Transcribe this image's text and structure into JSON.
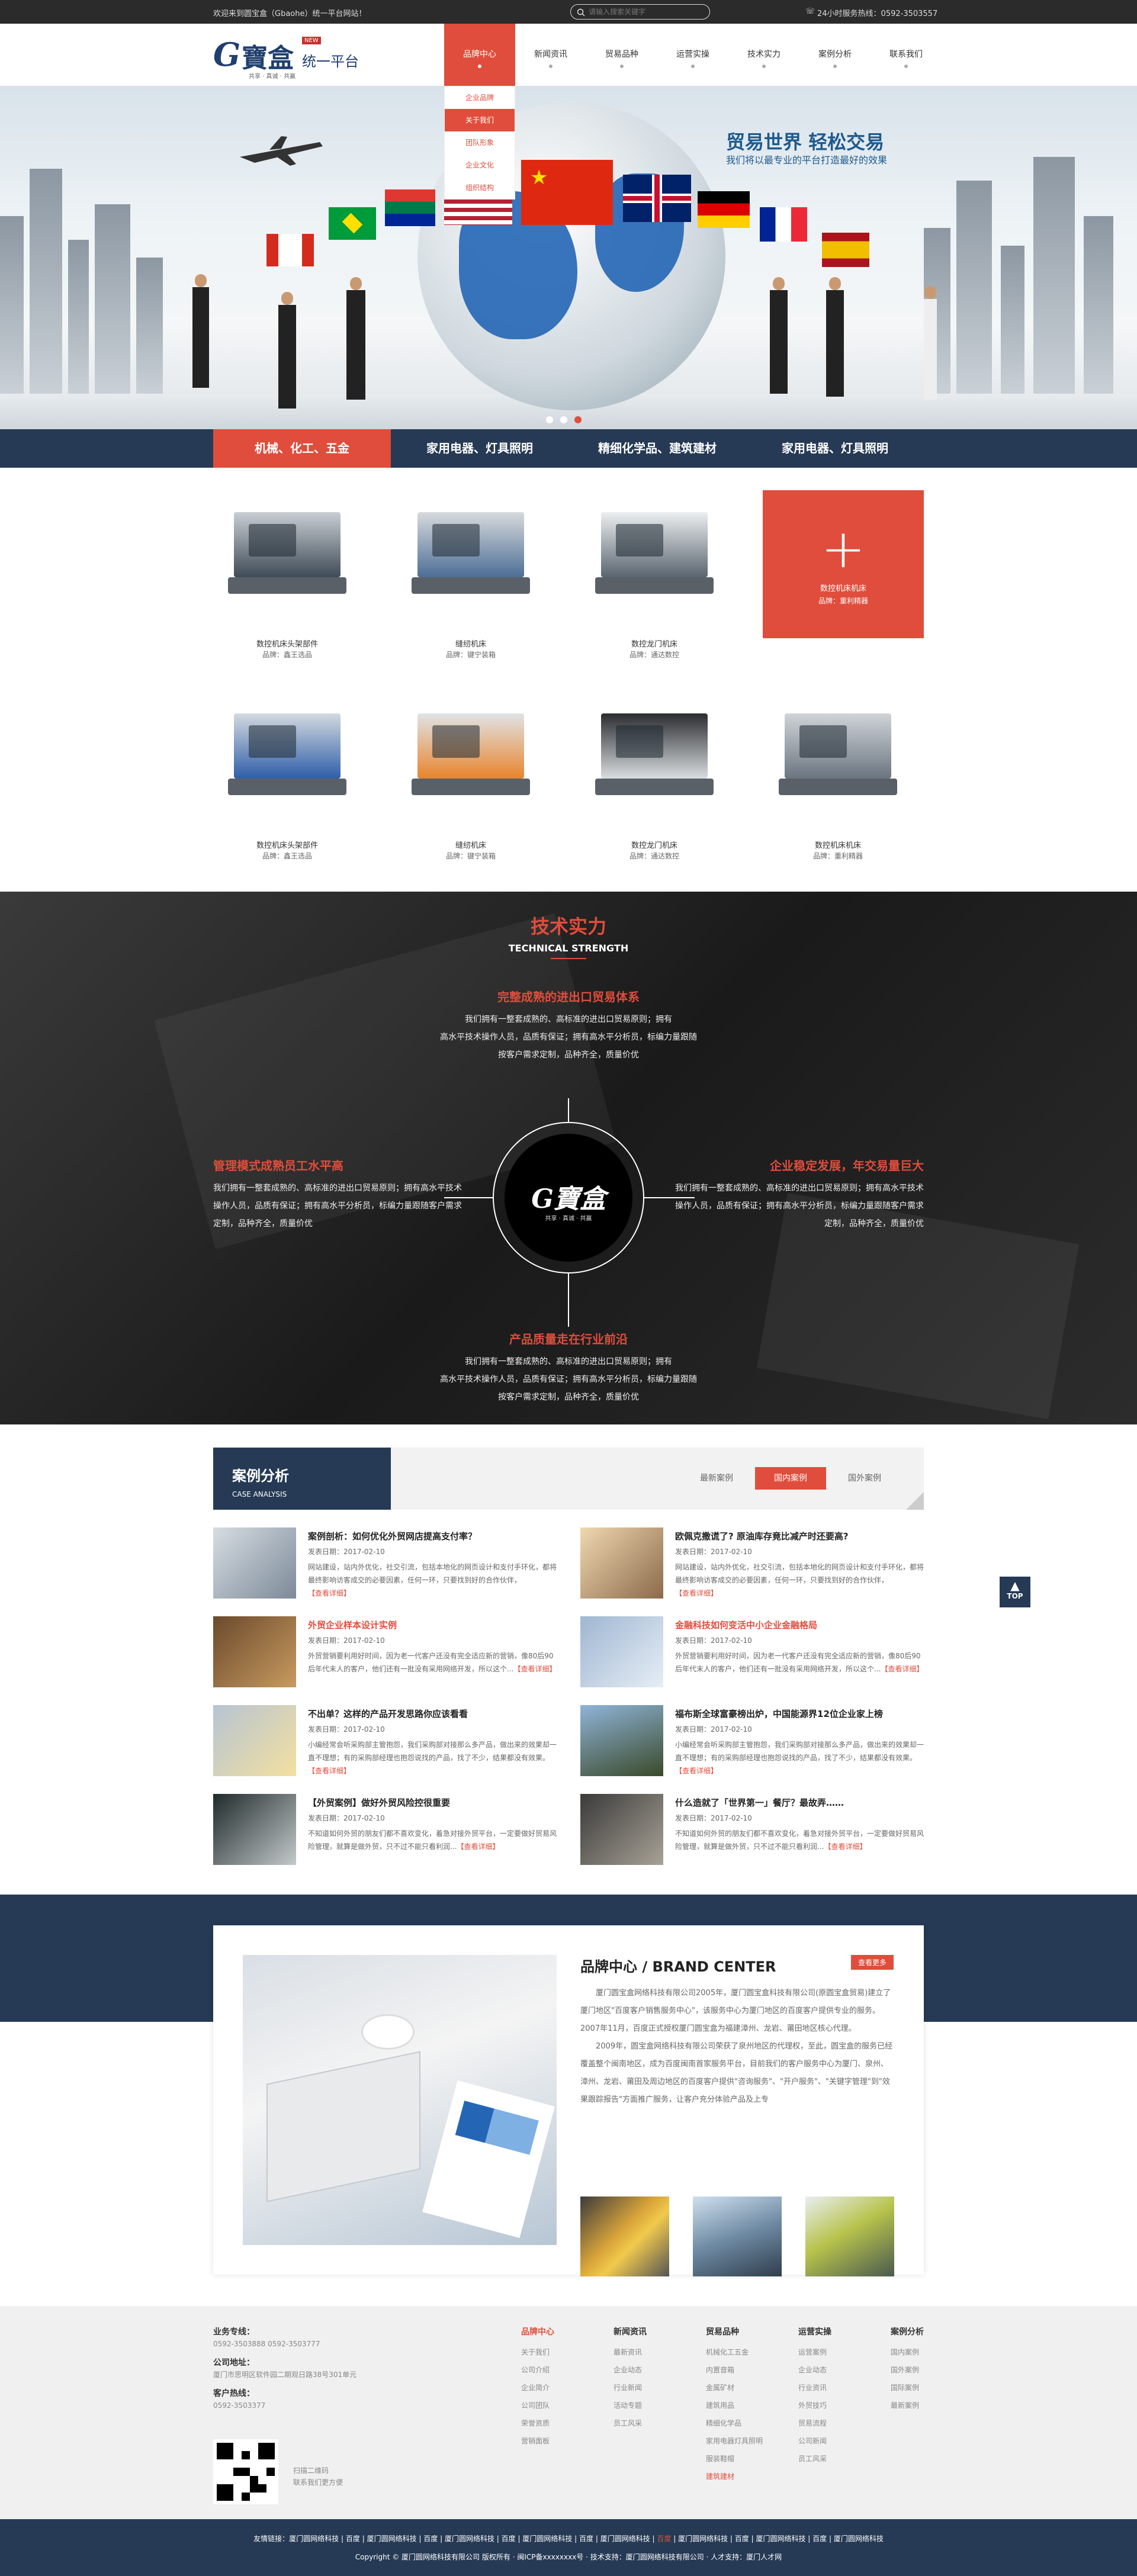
{
  "topbar": {
    "welcome": "欢迎来到圆宝盒（Gbaohe）统一平台网站！",
    "search_placeholder": "请输入搜索关键字",
    "hotline": "24小时服务热线：0592-3503557"
  },
  "logo": {
    "mark": "G",
    "name": "寶盒",
    "badge": "NEW",
    "platform": "统一平台",
    "tagline": "共享 · 真诚 · 共赢"
  },
  "nav": [
    {
      "label": "品牌中心",
      "active": true
    },
    {
      "label": "新闻资讯",
      "active": false
    },
    {
      "label": "贸易品种",
      "active": false
    },
    {
      "label": "运营实操",
      "active": false
    },
    {
      "label": "技术实力",
      "active": false
    },
    {
      "label": "案例分析",
      "active": false
    },
    {
      "label": "联系我们",
      "active": false
    }
  ],
  "dropdown": [
    {
      "label": "企业品牌",
      "on": false
    },
    {
      "label": "关于我们",
      "on": true
    },
    {
      "label": "团队形象",
      "on": false
    },
    {
      "label": "企业文化",
      "on": false
    },
    {
      "label": "组织结构",
      "on": false
    }
  ],
  "banner": {
    "headline": "贸易世界 轻松交易",
    "subline": "我们将以最专业的平台打造最好的效果"
  },
  "categories": [
    {
      "label": "机械、化工、五金",
      "on": true
    },
    {
      "label": "家用电器、灯具照明",
      "on": false
    },
    {
      "label": "精细化学品、建筑建材",
      "on": false
    },
    {
      "label": "家用电器、灯具照明",
      "on": false
    }
  ],
  "products_row1": [
    {
      "name": "数控机床头架部件",
      "brand": "品牌：鑫王选品"
    },
    {
      "name": "缝纫机床",
      "brand": "品牌：键宁装箱"
    },
    {
      "name": "数控龙门机床",
      "brand": "品牌：通达数控"
    }
  ],
  "product_more": {
    "plus": "+",
    "name": "数控机床机床",
    "brand": "品牌：重利精器"
  },
  "products_row2": [
    {
      "name": "数控机床头架部件",
      "brand": "品牌：鑫王选品"
    },
    {
      "name": "缝纫机床",
      "brand": "品牌：键宁装箱"
    },
    {
      "name": "数控龙门机床",
      "brand": "品牌：通达数控"
    },
    {
      "name": "数控机床机床",
      "brand": "品牌：重利精器"
    }
  ],
  "tech": {
    "title_cn": "技术实力",
    "title_en": "TECHNICAL STRENGTH",
    "center_mark": "G寶盒",
    "center_sub": "共享 · 真诚 · 共赢",
    "blocks": [
      {
        "h": "完整成熟的进出口贸易体系",
        "p": [
          "我们拥有一整套成熟的、高标准的进出口贸易原则；拥有",
          "高水平技术操作人员，品质有保证；拥有高水平分析员，标编力量跟随",
          "按客户需求定制，品种齐全，质量价优"
        ]
      },
      {
        "h": "管理模式成熟员工水平高",
        "p": [
          "我们拥有一整套成熟的、高标准的进出口贸易原则；拥有高水平技术",
          "操作人员，品质有保证；拥有高水平分析员，标编力量跟随客户需求",
          "定制，品种齐全，质量价优"
        ]
      },
      {
        "h": "企业稳定发展，年交易量巨大",
        "p": [
          "我们拥有一整套成熟的、高标准的进出口贸易原则；拥有高水平技术",
          "操作人员，品质有保证；拥有高水平分析员，标编力量跟随客户需求",
          "定制，品种齐全，质量价优"
        ]
      },
      {
        "h": "产品质量走在行业前沿",
        "p": [
          "我们拥有一整套成熟的、高标准的进出口贸易原则；拥有",
          "高水平技术操作人员，品质有保证；拥有高水平分析员，标编力量跟随",
          "按客户需求定制，品种齐全，质量价优"
        ]
      }
    ]
  },
  "cases": {
    "title": "案例分析",
    "subtitle": "CASE ANALYSIS",
    "tabs": [
      {
        "label": "最新案例",
        "on": false
      },
      {
        "label": "国内案例",
        "on": true
      },
      {
        "label": "国外案例",
        "on": false
      }
    ],
    "items": [
      {
        "title": "案例剖析：如何优化外贸网店提高支付率？",
        "date": "发表日期：2017-02-10",
        "text": "网站建设，站内外优化，社交引流，包括本地化的网页设计和支付手环化，都将最终影响访客成交的必要因素，任何一环，只要找到好的合作伙伴，",
        "more": "【查看详细】",
        "red": false
      },
      {
        "title": "欧佩克撒谎了? 原油库存竟比减产时还要高?",
        "date": "发表日期：2017-02-10",
        "text": "网站建设，站内外优化，社交引流，包括本地化的网页设计和支付手环化，都将最终影响访客成交的必要因素，任何一环，只要找到好的合作伙伴，",
        "more": "【查看详细】",
        "red": false
      },
      {
        "title": "外贸企业样本设计实例",
        "date": "发表日期：2017-02-10",
        "text": "外贸营销要利用好时间，因为老一代客户还没有完全适应新的营销，像80后90后年代末人的客户，他们还有一批没有采用网络开发，所以这个...",
        "more": "【查看详细】",
        "red": true
      },
      {
        "title": "金融科技如何变活中小企业金融格局",
        "date": "发表日期：2017-02-10",
        "text": "外贸营销要利用好时间，因为老一代客户还没有完全适应新的营销，像80后90后年代末人的客户，他们还有一批没有采用网络开发，所以这个...",
        "more": "【查看详细】",
        "red": true
      },
      {
        "title": "不出单？这样的产品开发思路你应该看看",
        "date": "发表日期：2017-02-10",
        "text": "小编经常会听采购部主管抱怨，我们采购部对接那么多产品，做出来的效果却一直不理想；有的采购部经理也抱怨说找的产品，找了不少，结果都没有效果。",
        "more": "【查看详细】",
        "red": false
      },
      {
        "title": "福布斯全球富豪榜出炉，中国能源界12位企业家上榜",
        "date": "发表日期：2017-02-10",
        "text": "小编经常会听采购部主管抱怨，我们采购部对接那么多产品，做出来的效果却一直不理想；有的采购部经理也抱怨说找的产品，找了不少，结果都没有效果。",
        "more": "【查看详细】",
        "red": false
      },
      {
        "title": "【外贸案例】做好外贸风险控很重要",
        "date": "发表日期：2017-02-10",
        "text": "不知道如何外贸的朋友们都不喜欢变化，着急对接外贸平台，一定要做好贸易风险管理，就算是做外贸，只不过不能只看利润...",
        "more": "【查看详细】",
        "red": false
      },
      {
        "title": "什么造就了「世界第一」餐厅？最故弄……",
        "date": "发表日期：2017-02-10",
        "text": "不知道如何外贸的朋友们都不喜欢变化，着急对接外贸平台，一定要做好贸易风险管理，就算是做外贸，只不过不能只看利润...",
        "more": "【查看详细】",
        "red": false
      }
    ]
  },
  "totop": "TOP",
  "brand": {
    "title": "品牌中心 / BRAND CENTER",
    "more": "查看更多",
    "p1": "厦门圆宝盒网络科技有限公司2005年，厦门圆宝盒科技有限公司(原圆宝盒贸易)建立了厦门地区\"百度客户销售服务中心\"，该服务中心为厦门地区的百度客户提供专业的服务。2007年11月，百度正式授权厦门圆宝盒为福建漳州、龙岩、莆田地区核心代理。",
    "p2": "2009年，圆宝盒网络科技有限公司荣获了泉州地区的代理权，至此，圆宝盒的服务已经覆盖整个闽南地区，成为百度闽南首家服务平台，目前我们的客户服务中心为厦门、泉州、漳州、龙岩、莆田及周边地区的百度客户提供\"咨询服务\"、\"开户服务\"、\"关键字管理\"到\"效果跟踪报告\"方面推广服务，让客户充分体验产品及上专"
  },
  "footer": {
    "contact": [
      {
        "h": "业务专线：",
        "v": "0592-3503888  0592-3503777"
      },
      {
        "h": "公司地址：",
        "v": "厦门市思明区软件园二期观日路38号301单元"
      },
      {
        "h": "客户热线：",
        "v": "0592-3503377"
      }
    ],
    "qr_caption": [
      "扫描二维码",
      "联系我们更方便"
    ],
    "columns": [
      {
        "head": "品牌中心",
        "red": true,
        "items": [
          "关于我们",
          "公司介绍",
          "企业简介",
          "公司团队",
          "荣誉资质",
          "营销面板"
        ]
      },
      {
        "head": "新闻资讯",
        "red": false,
        "items": [
          "最新资讯",
          "企业动态",
          "行业新闻",
          "活动专题",
          "员工风采"
        ]
      },
      {
        "head": "贸易品种",
        "red": false,
        "items": [
          "机械化工五金",
          "内置音箱",
          "金属矿材",
          "建筑用品",
          "精细化学品",
          "家用电器灯具照明",
          "服装鞋帽",
          "建筑建材"
        ]
      },
      {
        "head": "运营实操",
        "red": false,
        "items": [
          "运营案例",
          "企业动态",
          "行业资讯",
          "外贸技巧",
          "贸易流程",
          "公司新闻",
          "员工风采"
        ]
      },
      {
        "head": "案例分析",
        "red": false,
        "items": [
          "国内案例",
          "国外案例",
          "国际案例",
          "最新案例"
        ]
      }
    ],
    "links_label": "友情链接：",
    "links": [
      "厦门圆网络科技",
      "百度",
      "厦门圆网络科技",
      "百度",
      "厦门圆网络科技",
      "百度",
      "厦门圆网络科技",
      "百度",
      "厦门圆网络科技",
      "百度",
      "厦门圆网络科技",
      "百度",
      "厦门圆网络科技",
      "百度",
      "厦门圆网络科技"
    ],
    "copyright": "Copyright © 厦门圆网络科技有限公司 版权所有 · 闽ICP备xxxxxxxx号 · 技术支持：厦门圆网络科技有限公司 · 人才支持：厦门人才网"
  },
  "colors": {
    "accent": "#e04d3c",
    "navy": "#263a55",
    "dark": "#2b2b2b"
  }
}
